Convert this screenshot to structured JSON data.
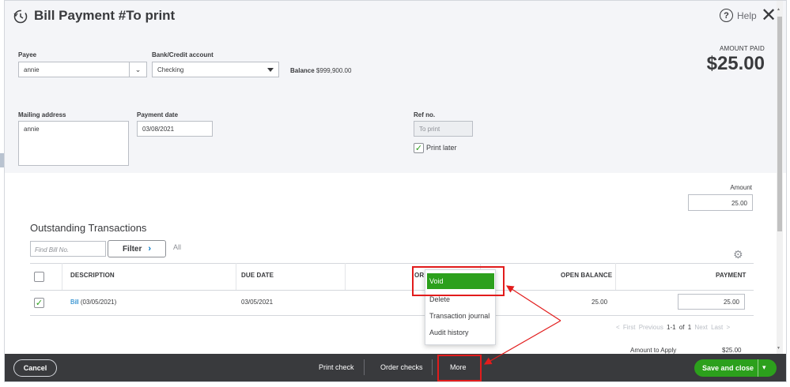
{
  "header": {
    "title": "Bill Payment #To print",
    "help_label": "Help",
    "amount_paid_label": "AMOUNT PAID",
    "amount_paid_value": "$25.00"
  },
  "form": {
    "payee_label": "Payee",
    "payee_value": "annie",
    "bank_label": "Bank/Credit account",
    "bank_value": "Checking",
    "balance_label": "Balance",
    "balance_value": "$999,900.00",
    "mailing_label": "Mailing address",
    "mailing_value": "annie",
    "payment_date_label": "Payment date",
    "payment_date_value": "03/08/2021",
    "ref_label": "Ref no.",
    "ref_placeholder": "To print",
    "print_later_label": "Print later",
    "print_later_checked": true,
    "amount_label": "Amount",
    "amount_value": "25.00"
  },
  "transactions": {
    "title": "Outstanding Transactions",
    "find_placeholder": "Find Bill No.",
    "filter_label": "Filter",
    "all_label": "All",
    "columns": [
      "DESCRIPTION",
      "DUE DATE",
      "OR",
      "OPEN BALANCE",
      "PAYMENT"
    ],
    "rows": [
      {
        "link": "Bill",
        "desc": " (03/05/2021)",
        "due": "03/05/2021",
        "open_balance": "25.00",
        "payment": "25.00",
        "checked": true
      }
    ],
    "pager": {
      "first": "< First",
      "previous": "Previous",
      "range": "1-1 of 1",
      "next": "Next",
      "last": "Last >"
    },
    "amount_to_apply_label": "Amount to Apply",
    "amount_to_apply_value": "$25.00"
  },
  "more_menu": {
    "items": [
      "Void",
      "Delete",
      "Transaction journal",
      "Audit history"
    ]
  },
  "footer": {
    "cancel": "Cancel",
    "print_check": "Print check",
    "order_checks": "Order checks",
    "more": "More",
    "save_close": "Save and close"
  },
  "colors": {
    "accent_green": "#2ca01c",
    "link_blue": "#0077c5",
    "annotation_red": "#e21c1c",
    "footer_bg": "#393a3d"
  }
}
